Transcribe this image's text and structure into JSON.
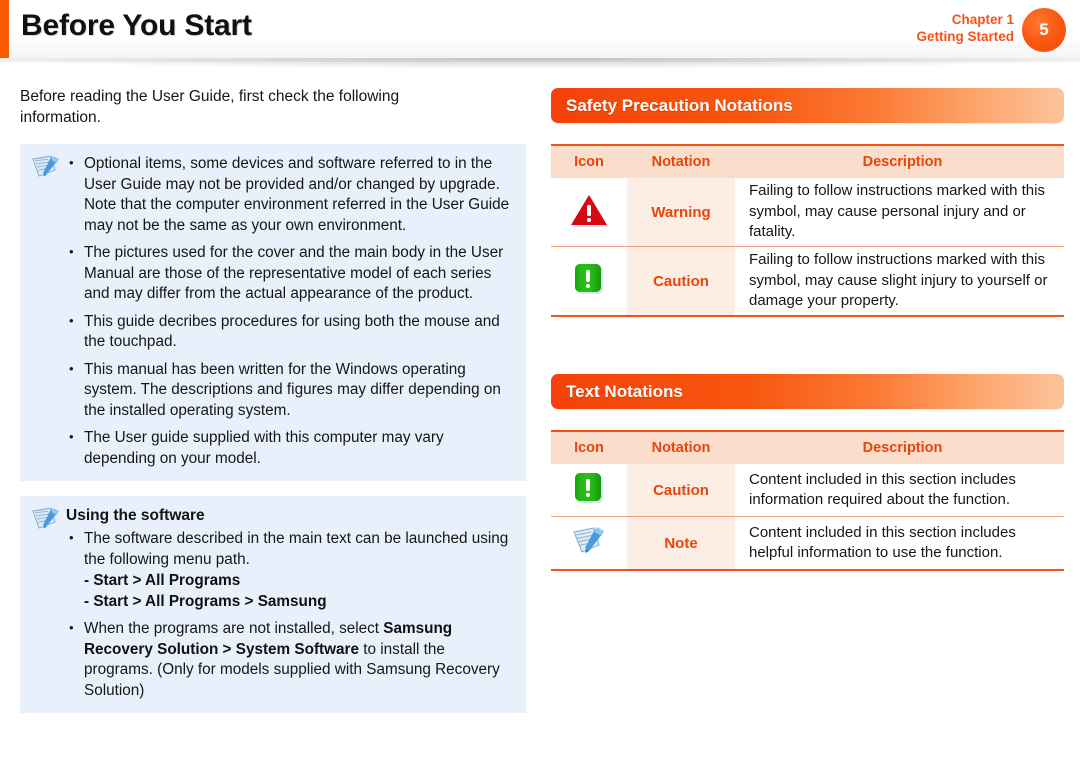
{
  "header": {
    "title": "Before You Start",
    "chapter_label": "Chapter 1",
    "chapter_name": "Getting Started",
    "page_number": "5"
  },
  "left_column": {
    "intro": "Before reading the User Guide, first check the following information.",
    "note_box_1": {
      "icon": "note-pen-icon",
      "bullets": [
        "Optional items, some devices and software referred to in the User Guide may not be provided and/or changed by upgrade.\nNote that the computer environment referred in the User Guide may not be the same as your own environment.",
        "The pictures used for the cover and the main body in the User Manual are those of the representative model of each series and may differ from the actual appearance of the product.",
        "This guide decribes procedures for using both the mouse and the touchpad.",
        "This manual has been written for the Windows operating system. The descriptions and figures may differ depending on the installed operating system.",
        "The User guide supplied with this computer may vary depending on your model."
      ]
    },
    "note_box_2": {
      "icon": "note-pen-icon",
      "heading": "Using the software",
      "bullet_1": "The software described in the main text can be launched using the following menu path.",
      "menu_path_1": "- Start > All Programs",
      "menu_path_2": "- Start > All Programs > Samsung",
      "bullet_2_part1": "When the programs are not installed, select ",
      "bullet_2_bold": "Samsung Recovery Solution > System Software",
      "bullet_2_part2": " to install the programs. (Only for models supplied with Samsung Recovery Solution)"
    }
  },
  "right_column": {
    "safety_section": {
      "title": "Safety Precaution Notations",
      "columns": [
        "Icon",
        "Notation",
        "Description"
      ],
      "rows": [
        {
          "icon": "warning-triangle-icon",
          "notation": "Warning",
          "description": "Failing to follow instructions marked with this symbol, may cause personal injury and or fatality."
        },
        {
          "icon": "caution-square-icon",
          "notation": "Caution",
          "description": "Failing to follow instructions marked with this symbol, may cause slight injury to yourself or damage your property."
        }
      ]
    },
    "text_section": {
      "title": "Text Notations",
      "columns": [
        "Icon",
        "Notation",
        "Description"
      ],
      "rows": [
        {
          "icon": "caution-square-icon",
          "notation": "Caution",
          "description": "Content included in this section includes information required about the function."
        },
        {
          "icon": "note-pen-icon",
          "notation": "Note",
          "description": "Content included in this section includes helpful information to use the function."
        }
      ]
    }
  },
  "colors": {
    "accent_orange": "#f4531a",
    "header_bar_orange": "#ff5a00",
    "note_box_blue": "#e8f1fb",
    "table_header_peach": "#fbddcc",
    "notation_cell_peach": "#fdeee5",
    "warning_red": "#d60812",
    "caution_green": "#22b31a"
  }
}
